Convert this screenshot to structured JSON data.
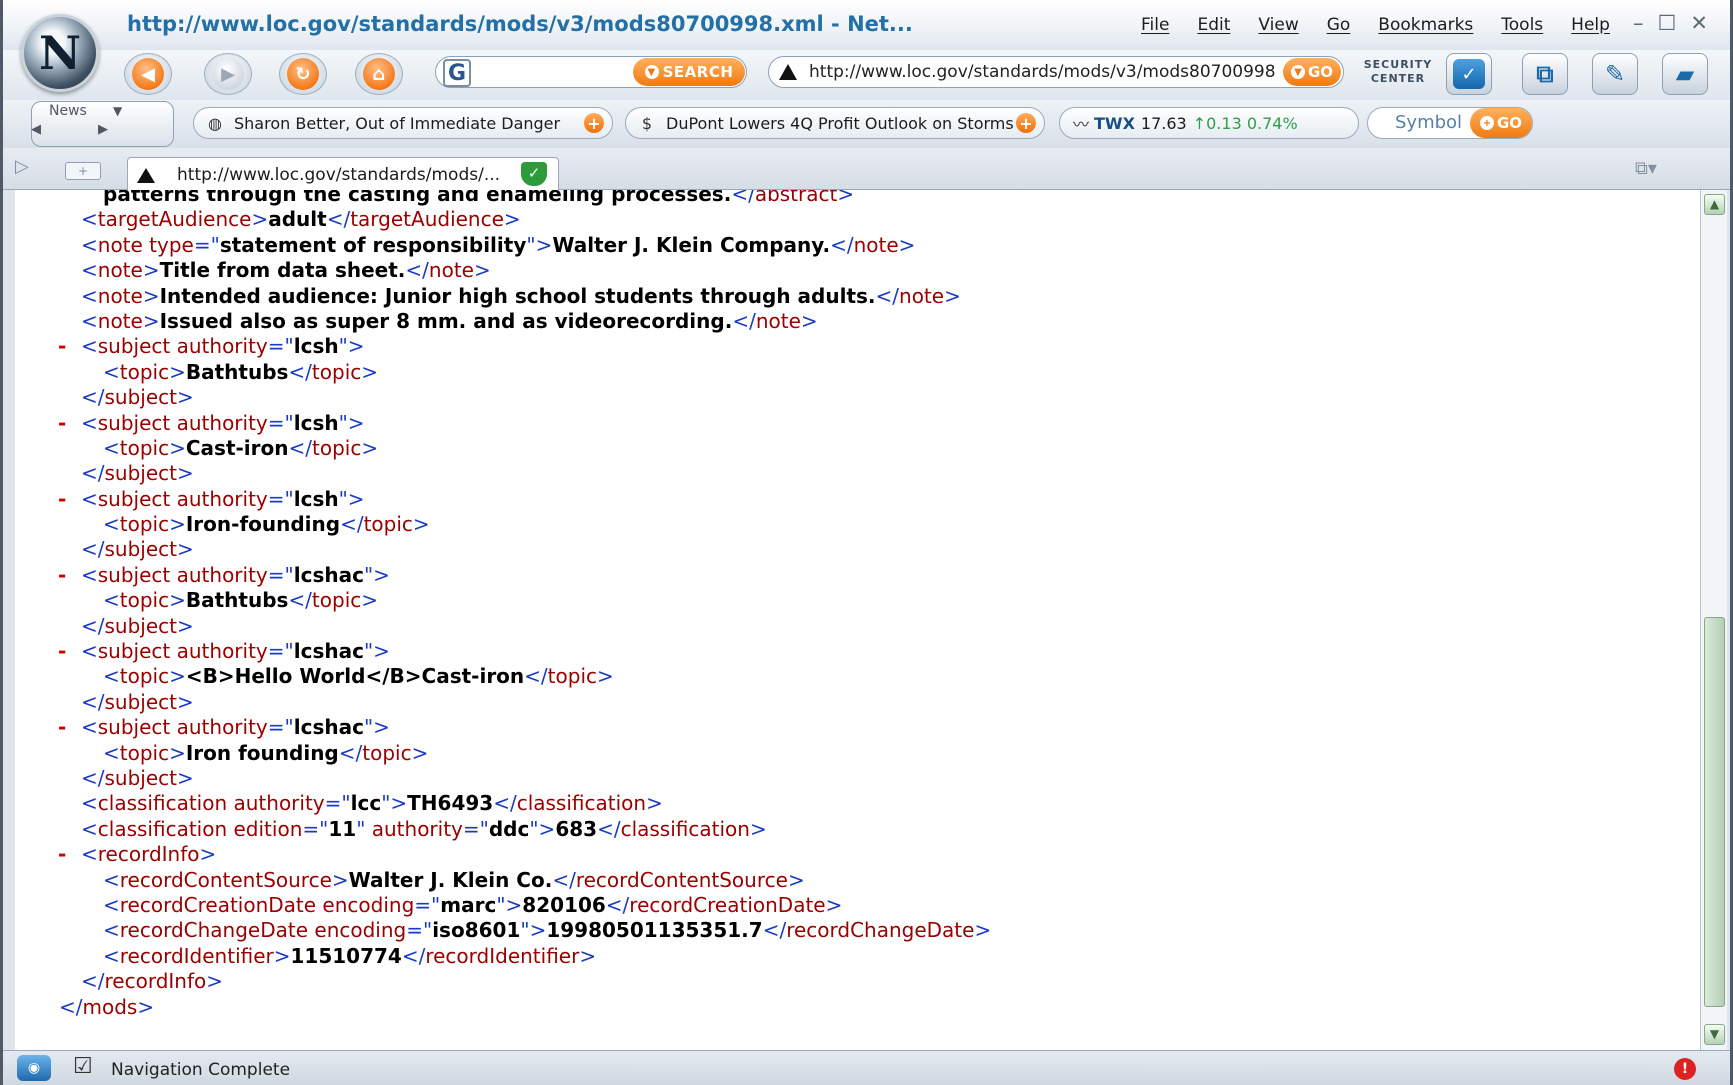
{
  "browser": {
    "title": "http://www.loc.gov/standards/mods/v3/mods80700998.xml - Net...",
    "logo_letter": "N",
    "menu": [
      "File",
      "Edit",
      "View",
      "Go",
      "Bookmarks",
      "Tools",
      "Help"
    ],
    "window_controls": [
      "–",
      "☐",
      "✕"
    ]
  },
  "navbar": {
    "search_button": "SEARCH",
    "search_value": "",
    "url": "http://www.loc.gov/standards/mods/v3/mods80700998",
    "go_label": "GO",
    "security_center": "SECURITY CENTER"
  },
  "personal_bar": {
    "news_label": "News",
    "headline_1": "Sharon Better, Out of Immediate Danger",
    "headline_2": "DuPont Lowers 4Q Profit Outlook on Storms",
    "ticker_symbol": "TWX",
    "ticker_price": "17.63",
    "ticker_change": "↑0.13 0.74%",
    "symbol_label": "Symbol",
    "symbol_go": "GO"
  },
  "tab": {
    "label": "http://www.loc.gov/standards/mods/..."
  },
  "document": {
    "abstract_tail": "patterns through the casting and enameling processes.",
    "targetAudience": "adult",
    "note_type": "statement of responsibility",
    "note_responsibility": "Walter J. Klein Company.",
    "note_2": "Title from data sheet.",
    "note_3": "Intended audience: Junior high school students through adults.",
    "note_4": "Issued also as super 8 mm. and as videorecording.",
    "subjects": [
      {
        "authority": "lcsh",
        "topic": "Bathtubs"
      },
      {
        "authority": "lcsh",
        "topic": "Cast-iron"
      },
      {
        "authority": "lcsh",
        "topic": "Iron-founding"
      },
      {
        "authority": "lcshac",
        "topic": "Bathtubs"
      },
      {
        "authority": "lcshac",
        "topic": "<B>Hello World</B>Cast-iron"
      },
      {
        "authority": "lcshac",
        "topic": "Iron founding"
      }
    ],
    "classification_1_authority": "lcc",
    "classification_1_value": "TH6493",
    "classification_2_edition": "11",
    "classification_2_authority": "ddc",
    "classification_2_value": "683",
    "recordContentSource": "Walter J. Klein Co.",
    "recordCreationDate_encoding": "marc",
    "recordCreationDate": "820106",
    "recordChangeDate_encoding": "iso8601",
    "recordChangeDate": "19980501135351.7",
    "recordIdentifier": "11510774"
  },
  "status": {
    "text": "Navigation Complete"
  }
}
